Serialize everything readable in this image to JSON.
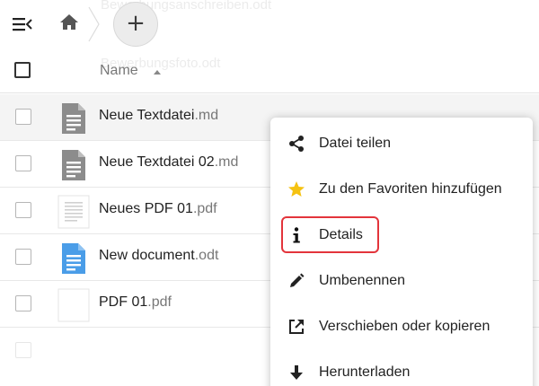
{
  "background_text": {
    "top_ghost": "Bewerbungsanschreiben.odt",
    "header_ghost": "Bewerbungsfoto.odt"
  },
  "list_header": {
    "name_label": "Name",
    "sort_direction": "ascending"
  },
  "files": [
    {
      "base": "Neue Textdatei",
      "ext": ".md",
      "icon": "text-file-icon",
      "hovered": true
    },
    {
      "base": "Neue Textdatei 02",
      "ext": ".md",
      "icon": "text-file-icon",
      "hovered": false
    },
    {
      "base": "Neues PDF 01",
      "ext": ".pdf",
      "icon": "pdf-thumbnail-icon",
      "hovered": false
    },
    {
      "base": "New document",
      "ext": ".odt",
      "icon": "document-icon",
      "hovered": false
    },
    {
      "base": "PDF 01",
      "ext": ".pdf",
      "icon": "blank-thumbnail-icon",
      "hovered": false
    }
  ],
  "context_menu": {
    "items": [
      {
        "label": "Datei teilen",
        "icon": "share-icon"
      },
      {
        "label": "Zu den Favoriten hinzufügen",
        "icon": "star-icon"
      },
      {
        "label": "Details",
        "icon": "info-icon",
        "highlighted": true
      },
      {
        "label": "Umbenennen",
        "icon": "pencil-icon"
      },
      {
        "label": "Verschieben oder kopieren",
        "icon": "external-link-icon"
      },
      {
        "label": "Herunterladen",
        "icon": "download-icon"
      }
    ]
  },
  "colors": {
    "highlight": "#e3343b",
    "star": "#f5c211",
    "document_icon": "#4a9de8",
    "file_icon": "#8c8c8c"
  }
}
